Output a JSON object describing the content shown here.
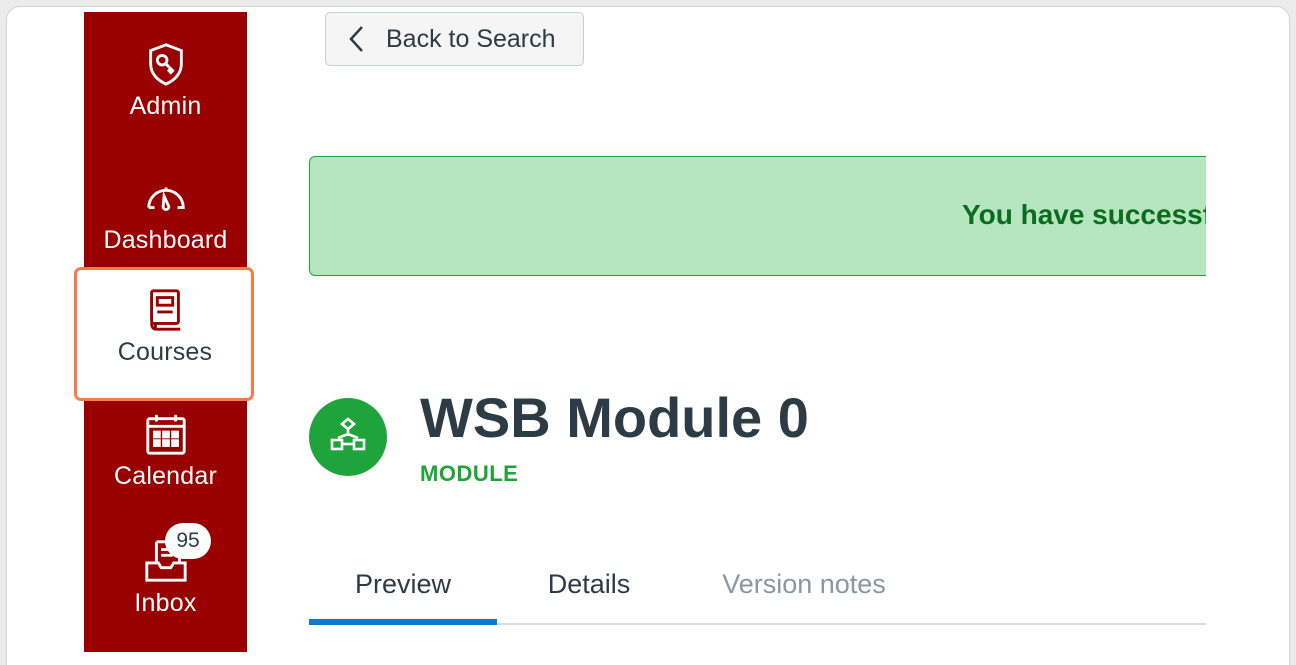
{
  "nav": {
    "admin": "Admin",
    "dashboard": "Dashboard",
    "courses": "Courses",
    "calendar": "Calendar",
    "inbox": "Inbox",
    "inbox_badge": "95"
  },
  "back_button": {
    "label": "Back to Search"
  },
  "alert": {
    "text": "You have successf"
  },
  "module": {
    "title": "WSB Module 0",
    "type": "MODULE"
  },
  "tabs": [
    {
      "label": "Preview",
      "active": true
    },
    {
      "label": "Details",
      "active": false
    },
    {
      "label": "Version notes",
      "active": false
    }
  ],
  "colors": {
    "sidebar": "#990000",
    "highlight": "#fa7a4c",
    "success": "#1fa33b",
    "alert_bg": "#b5e6bf",
    "tab_active": "#0b7ad1"
  }
}
